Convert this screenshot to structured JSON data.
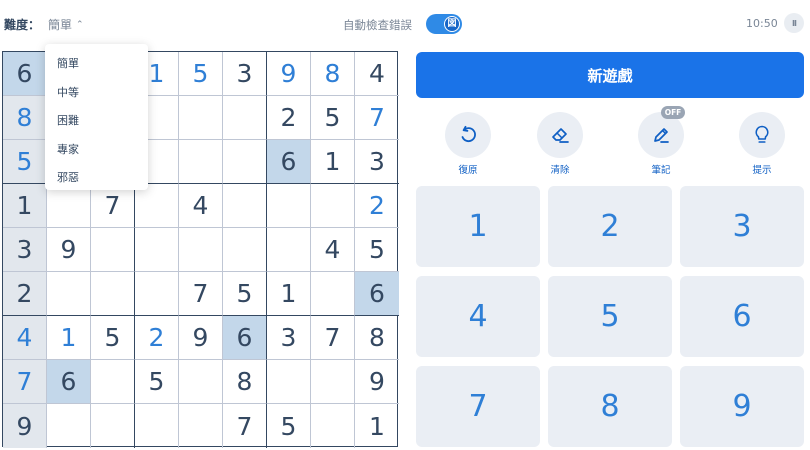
{
  "header": {
    "difficulty_label": "難度：",
    "difficulty_value": "簡單",
    "autocheck_label": "自動檢查錯誤",
    "toggle_glyph": "図",
    "timer": "10:50",
    "pause_glyph": "II"
  },
  "difficulty_menu": [
    "簡單",
    "中等",
    "困難",
    "專家",
    "邪惡"
  ],
  "board": [
    [
      "6",
      "",
      "",
      "1",
      "5",
      "3",
      "9",
      "8",
      "4"
    ],
    [
      "8",
      "",
      "",
      "",
      "",
      "",
      "2",
      "5",
      "7"
    ],
    [
      "5",
      "",
      "",
      "",
      "",
      "",
      "6",
      "1",
      "3"
    ],
    [
      "1",
      "",
      "7",
      "",
      "4",
      "",
      "",
      "",
      "2"
    ],
    [
      "3",
      "9",
      "",
      "",
      "",
      "",
      "",
      "4",
      "5"
    ],
    [
      "2",
      "",
      "",
      "",
      "7",
      "5",
      "1",
      "",
      "6"
    ],
    [
      "4",
      "1",
      "5",
      "2",
      "9",
      "6",
      "3",
      "7",
      "8"
    ],
    [
      "7",
      "6",
      "",
      "5",
      "",
      "8",
      "",
      "",
      "9"
    ],
    [
      "9",
      "",
      "",
      "",
      "",
      "7",
      "5",
      "",
      "1"
    ]
  ],
  "actions": {
    "new_game": "新遊戲",
    "undo": "復原",
    "erase": "清除",
    "notes": "筆記",
    "notes_badge": "OFF",
    "hint": "提示"
  },
  "numpad": [
    "1",
    "2",
    "3",
    "4",
    "5",
    "6",
    "7",
    "8",
    "9"
  ],
  "colors": {
    "accent": "#1a73e8",
    "given_digit": "#344861",
    "user_digit": "#2f7fd6",
    "highlight": "#e2e7ed",
    "same_number": "#c3d7ea"
  }
}
